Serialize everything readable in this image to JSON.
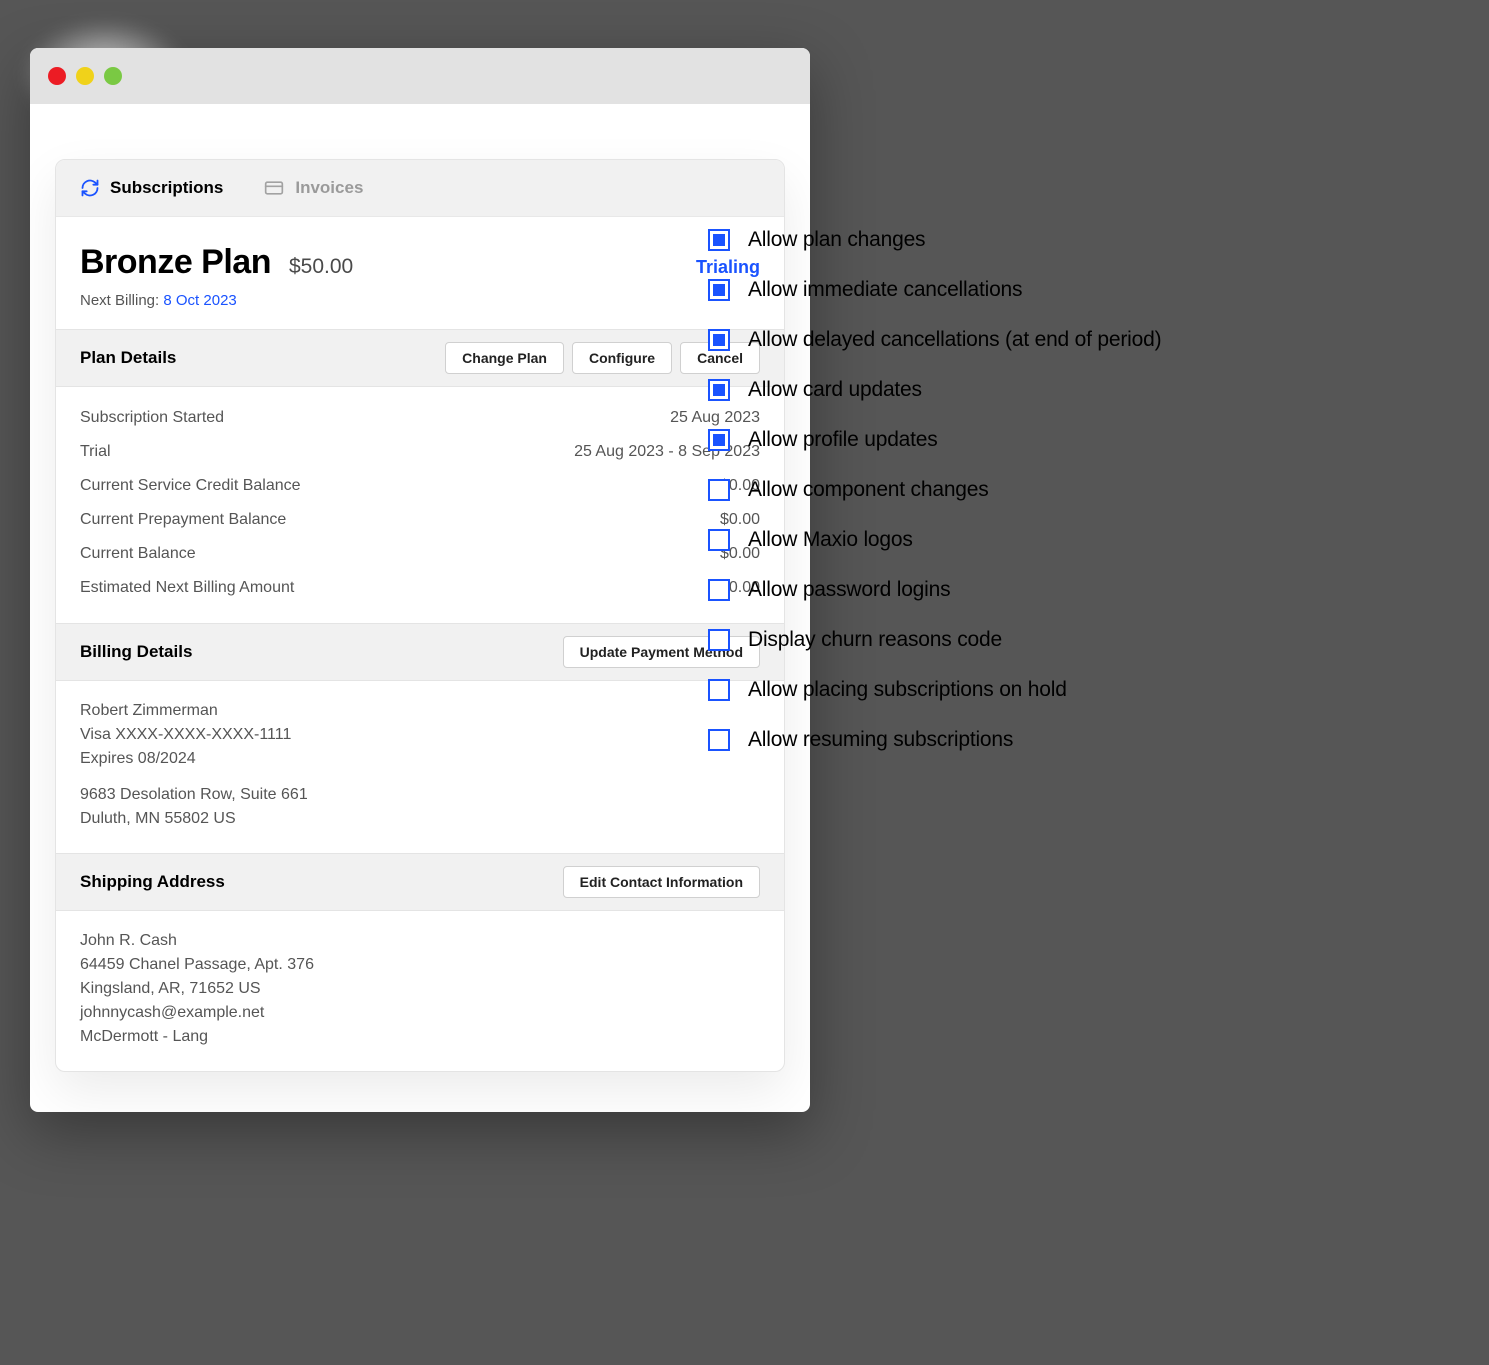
{
  "tabs": {
    "subscriptions": "Subscriptions",
    "invoices": "Invoices"
  },
  "plan": {
    "name": "Bronze Plan",
    "price": "$50.00",
    "status": "Trialing",
    "next_billing_label": "Next Billing:",
    "next_billing_date": "8 Oct 2023"
  },
  "plan_details": {
    "title": "Plan Details",
    "buttons": {
      "change_plan": "Change Plan",
      "configure": "Configure",
      "cancel": "Cancel"
    },
    "rows": [
      {
        "label": "Subscription Started",
        "value": "25 Aug 2023"
      },
      {
        "label": "Trial",
        "value": "25 Aug 2023 - 8 Sep 2023"
      },
      {
        "label": "Current Service Credit Balance",
        "value": "$0.00"
      },
      {
        "label": "Current Prepayment Balance",
        "value": "$0.00"
      },
      {
        "label": "Current Balance",
        "value": "$0.00"
      },
      {
        "label": "Estimated Next Billing Amount",
        "value": "$50.00"
      }
    ]
  },
  "billing": {
    "title": "Billing Details",
    "button": "Update Payment Method",
    "name": "Robert Zimmerman",
    "card": "Visa XXXX-XXXX-XXXX-1111",
    "expires": "Expires 08/2024",
    "address1": "9683 Desolation Row, Suite 661",
    "address2": "Duluth, MN 55802 US"
  },
  "shipping": {
    "title": "Shipping Address",
    "button": "Edit Contact Information",
    "name": "John R. Cash",
    "address1": "64459 Chanel Passage, Apt. 376",
    "address2": "Kingsland, AR, 71652 US",
    "email": "johnnycash@example.net",
    "company": "McDermott - Lang"
  },
  "settings": [
    {
      "label": "Allow plan changes",
      "checked": true
    },
    {
      "label": "Allow immediate cancellations",
      "checked": true
    },
    {
      "label": "Allow delayed cancellations (at end of period)",
      "checked": true
    },
    {
      "label": "Allow card updates",
      "checked": true
    },
    {
      "label": "Allow profile updates",
      "checked": true
    },
    {
      "label": "Allow component changes",
      "checked": false
    },
    {
      "label": "Allow Maxio logos",
      "checked": false
    },
    {
      "label": "Allow password logins",
      "checked": false
    },
    {
      "label": "Display churn reasons code",
      "checked": false
    },
    {
      "label": "Allow placing subscriptions on hold",
      "checked": false
    },
    {
      "label": "Allow resuming subscriptions",
      "checked": false
    }
  ]
}
